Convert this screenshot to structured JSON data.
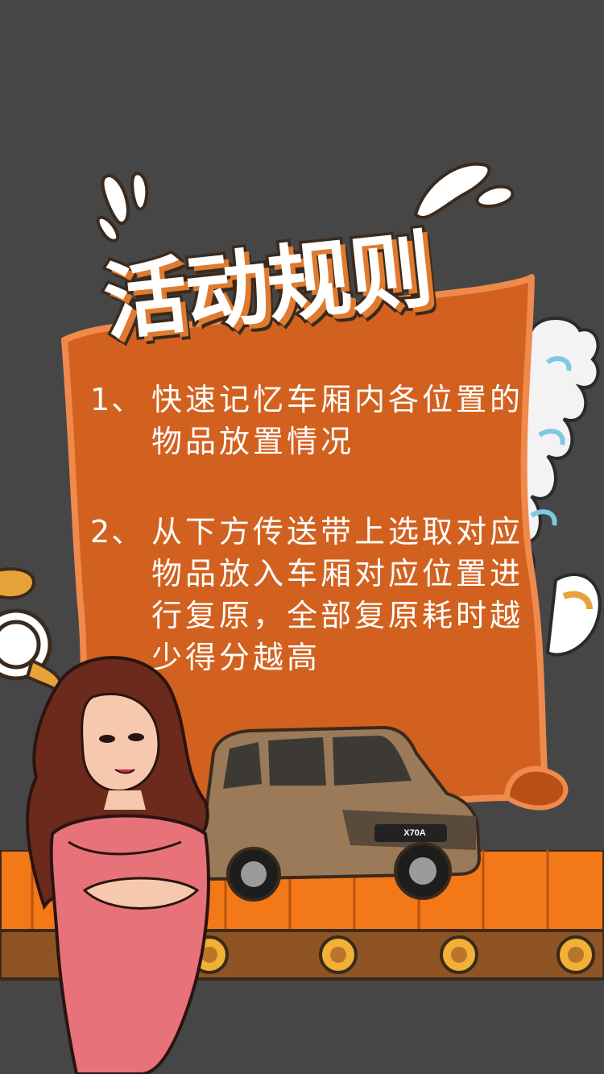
{
  "title": "活动规则",
  "rules": [
    {
      "num": "1、",
      "text": "快速记忆车厢内各位置的物品放置情况"
    },
    {
      "num": "2、",
      "text": "从下方传送带上选取对应物品放入车厢对应位置进行复原，全部复原耗时越少得分越高"
    }
  ],
  "car_badge": "X70A",
  "colors": {
    "background": "#464646",
    "scroll": "#d2611f",
    "scroll_border": "#f08a4c",
    "conveyor": "#f27818",
    "text": "#ffffff"
  },
  "icons": {
    "title_splash": "splash-icon",
    "car": "suv-car-illustration",
    "woman": "woman-character-illustration",
    "conveyor": "conveyor-belt-illustration"
  }
}
